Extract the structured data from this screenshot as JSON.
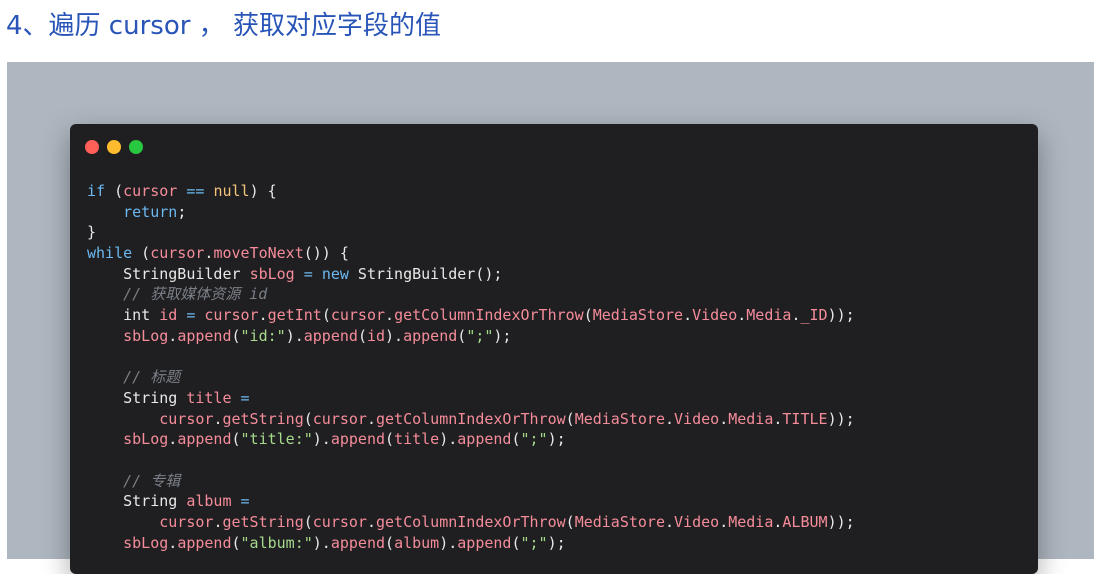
{
  "heading": "4、遍历 cursor ， 获取对应字段的值",
  "window": {
    "controls": [
      "close-dot",
      "minimize-dot",
      "zoom-dot"
    ]
  },
  "code_lines": [
    [
      [
        "kw",
        "if"
      ],
      [
        "pl",
        " ("
      ],
      [
        "var",
        "cursor"
      ],
      [
        "pl",
        " "
      ],
      [
        "kw",
        "=="
      ],
      [
        "pl",
        " "
      ],
      [
        "lit",
        "null"
      ],
      [
        "pl",
        ") {"
      ]
    ],
    [
      [
        "pl",
        "    "
      ],
      [
        "kw",
        "return"
      ],
      [
        "pl",
        ";"
      ]
    ],
    [
      [
        "pl",
        "}"
      ]
    ],
    [
      [
        "kw",
        "while"
      ],
      [
        "pl",
        " ("
      ],
      [
        "var",
        "cursor"
      ],
      [
        "pl",
        "."
      ],
      [
        "var",
        "moveToNext"
      ],
      [
        "pl",
        "()) {"
      ]
    ],
    [
      [
        "pl",
        "    StringBuilder "
      ],
      [
        "var",
        "sbLog"
      ],
      [
        "pl",
        " "
      ],
      [
        "kw",
        "="
      ],
      [
        "pl",
        " "
      ],
      [
        "kw",
        "new"
      ],
      [
        "pl",
        " StringBuilder();"
      ]
    ],
    [
      [
        "pl",
        "    "
      ],
      [
        "cm",
        "// 获取媒体资源 id"
      ]
    ],
    [
      [
        "pl",
        "    int "
      ],
      [
        "var",
        "id"
      ],
      [
        "pl",
        " "
      ],
      [
        "kw",
        "="
      ],
      [
        "pl",
        " "
      ],
      [
        "var",
        "cursor"
      ],
      [
        "pl",
        "."
      ],
      [
        "var",
        "getInt"
      ],
      [
        "pl",
        "("
      ],
      [
        "var",
        "cursor"
      ],
      [
        "pl",
        "."
      ],
      [
        "var",
        "getColumnIndexOrThrow"
      ],
      [
        "pl",
        "("
      ],
      [
        "var",
        "MediaStore"
      ],
      [
        "pl",
        "."
      ],
      [
        "var",
        "Video"
      ],
      [
        "pl",
        "."
      ],
      [
        "var",
        "Media"
      ],
      [
        "pl",
        "."
      ],
      [
        "var",
        "_ID"
      ],
      [
        "pl",
        "));"
      ]
    ],
    [
      [
        "pl",
        "    "
      ],
      [
        "var",
        "sbLog"
      ],
      [
        "pl",
        "."
      ],
      [
        "var",
        "append"
      ],
      [
        "pl",
        "("
      ],
      [
        "str",
        "\"id:\""
      ],
      [
        "pl",
        ")."
      ],
      [
        "var",
        "append"
      ],
      [
        "pl",
        "("
      ],
      [
        "var",
        "id"
      ],
      [
        "pl",
        ")."
      ],
      [
        "var",
        "append"
      ],
      [
        "pl",
        "("
      ],
      [
        "str",
        "\";\""
      ],
      [
        "pl",
        ");"
      ]
    ],
    [],
    [
      [
        "pl",
        "    "
      ],
      [
        "cm",
        "// 标题"
      ]
    ],
    [
      [
        "pl",
        "    String "
      ],
      [
        "var",
        "title"
      ],
      [
        "pl",
        " "
      ],
      [
        "kw",
        "="
      ]
    ],
    [
      [
        "pl",
        "        "
      ],
      [
        "var",
        "cursor"
      ],
      [
        "pl",
        "."
      ],
      [
        "var",
        "getString"
      ],
      [
        "pl",
        "("
      ],
      [
        "var",
        "cursor"
      ],
      [
        "pl",
        "."
      ],
      [
        "var",
        "getColumnIndexOrThrow"
      ],
      [
        "pl",
        "("
      ],
      [
        "var",
        "MediaStore"
      ],
      [
        "pl",
        "."
      ],
      [
        "var",
        "Video"
      ],
      [
        "pl",
        "."
      ],
      [
        "var",
        "Media"
      ],
      [
        "pl",
        "."
      ],
      [
        "var",
        "TITLE"
      ],
      [
        "pl",
        "));"
      ]
    ],
    [
      [
        "pl",
        "    "
      ],
      [
        "var",
        "sbLog"
      ],
      [
        "pl",
        "."
      ],
      [
        "var",
        "append"
      ],
      [
        "pl",
        "("
      ],
      [
        "str",
        "\"title:\""
      ],
      [
        "pl",
        ")."
      ],
      [
        "var",
        "append"
      ],
      [
        "pl",
        "("
      ],
      [
        "var",
        "title"
      ],
      [
        "pl",
        ")."
      ],
      [
        "var",
        "append"
      ],
      [
        "pl",
        "("
      ],
      [
        "str",
        "\";\""
      ],
      [
        "pl",
        ");"
      ]
    ],
    [],
    [
      [
        "pl",
        "    "
      ],
      [
        "cm",
        "// 专辑"
      ]
    ],
    [
      [
        "pl",
        "    String "
      ],
      [
        "var",
        "album"
      ],
      [
        "pl",
        " "
      ],
      [
        "kw",
        "="
      ]
    ],
    [
      [
        "pl",
        "        "
      ],
      [
        "var",
        "cursor"
      ],
      [
        "pl",
        "."
      ],
      [
        "var",
        "getString"
      ],
      [
        "pl",
        "("
      ],
      [
        "var",
        "cursor"
      ],
      [
        "pl",
        "."
      ],
      [
        "var",
        "getColumnIndexOrThrow"
      ],
      [
        "pl",
        "("
      ],
      [
        "var",
        "MediaStore"
      ],
      [
        "pl",
        "."
      ],
      [
        "var",
        "Video"
      ],
      [
        "pl",
        "."
      ],
      [
        "var",
        "Media"
      ],
      [
        "pl",
        "."
      ],
      [
        "var",
        "ALBUM"
      ],
      [
        "pl",
        "));"
      ]
    ],
    [
      [
        "pl",
        "    "
      ],
      [
        "var",
        "sbLog"
      ],
      [
        "pl",
        "."
      ],
      [
        "var",
        "append"
      ],
      [
        "pl",
        "("
      ],
      [
        "str",
        "\"album:\""
      ],
      [
        "pl",
        ")."
      ],
      [
        "var",
        "append"
      ],
      [
        "pl",
        "("
      ],
      [
        "var",
        "album"
      ],
      [
        "pl",
        ")."
      ],
      [
        "var",
        "append"
      ],
      [
        "pl",
        "("
      ],
      [
        "str",
        "\";\""
      ],
      [
        "pl",
        ");"
      ]
    ]
  ]
}
